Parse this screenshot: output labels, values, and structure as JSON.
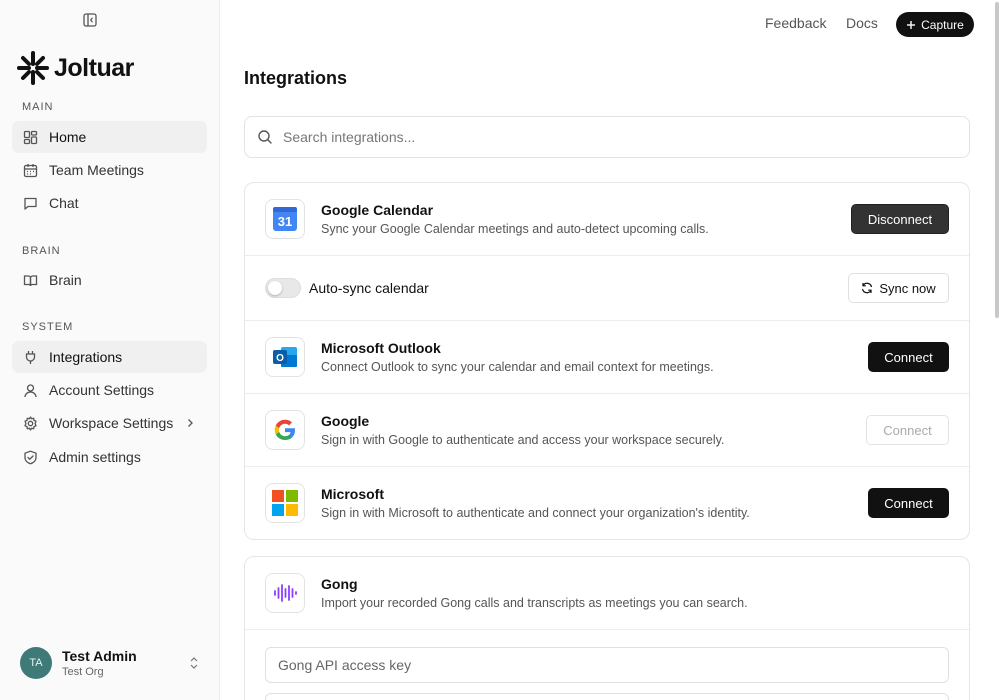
{
  "brand": {
    "name": "Joltuar"
  },
  "topbar": {
    "feedback": "Feedback",
    "docs": "Docs",
    "capture": "Capture"
  },
  "sidebar": {
    "sections": {
      "main": "MAIN",
      "brain": "BRAIN",
      "system": "SYSTEM"
    },
    "items": {
      "home": "Home",
      "team_meetings": "Team Meetings",
      "chat": "Chat",
      "brain": "Brain",
      "integrations": "Integrations",
      "account_settings": "Account Settings",
      "workspace_settings": "Workspace Settings",
      "admin_settings": "Admin settings"
    },
    "user": {
      "initials": "TA",
      "name": "Test Admin",
      "org": "Test Org"
    }
  },
  "main": {
    "title": "Integrations",
    "search_placeholder": "Search integrations...",
    "integrations": {
      "google_calendar": {
        "icon_text": "31",
        "name": "Google Calendar",
        "description": "Sync your Google Calendar meetings and auto-detect upcoming calls.",
        "button": "Disconnect"
      },
      "auto_sync": {
        "label": "Auto-sync calendar",
        "enabled": false,
        "sync_button": "Sync now"
      },
      "outlook": {
        "icon_text": "O",
        "name": "Microsoft Outlook",
        "description": "Connect Outlook to sync your calendar and email context for meetings.",
        "button": "Connect"
      },
      "google": {
        "name": "Google",
        "description": "Sign in with Google to authenticate and access your workspace securely.",
        "button": "Connect"
      },
      "microsoft": {
        "name": "Microsoft",
        "description": "Sign in with Microsoft to authenticate and connect your organization's identity.",
        "button": "Connect"
      },
      "gong": {
        "name": "Gong",
        "description": "Import your recorded Gong calls and transcripts as meetings you can search.",
        "api_key_placeholder": "Gong API access key"
      }
    }
  },
  "colors": {
    "accent": "#111111",
    "avatar": "#3d7a78",
    "gong": "#8a3ffc"
  }
}
